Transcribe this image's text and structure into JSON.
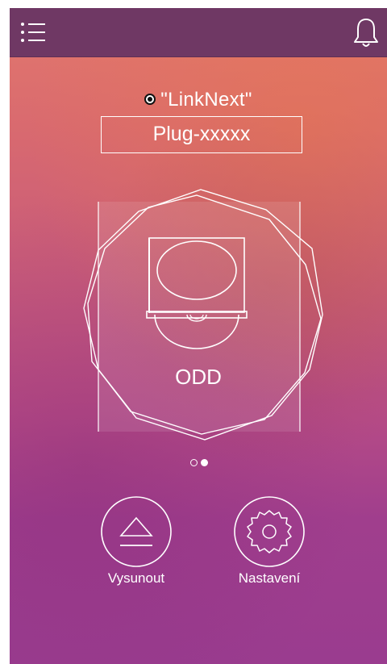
{
  "header": {
    "menu_icon": "menu-list-icon",
    "notification_icon": "bell-icon"
  },
  "device": {
    "status_icon": "radio-dot-icon",
    "title": "\"LinkNext\"",
    "name": "Plug-xxxxx"
  },
  "drive": {
    "icon": "optical-disc-drive-icon",
    "label": "ODD"
  },
  "pager": {
    "pages": 2,
    "active_index": 1
  },
  "actions": {
    "eject_label": "Vysunout",
    "eject_icon": "eject-icon",
    "settings_label": "Nastavení",
    "settings_icon": "gear-icon"
  },
  "colors": {
    "topbar": "#6f3864",
    "foreground": "#ffffff"
  }
}
